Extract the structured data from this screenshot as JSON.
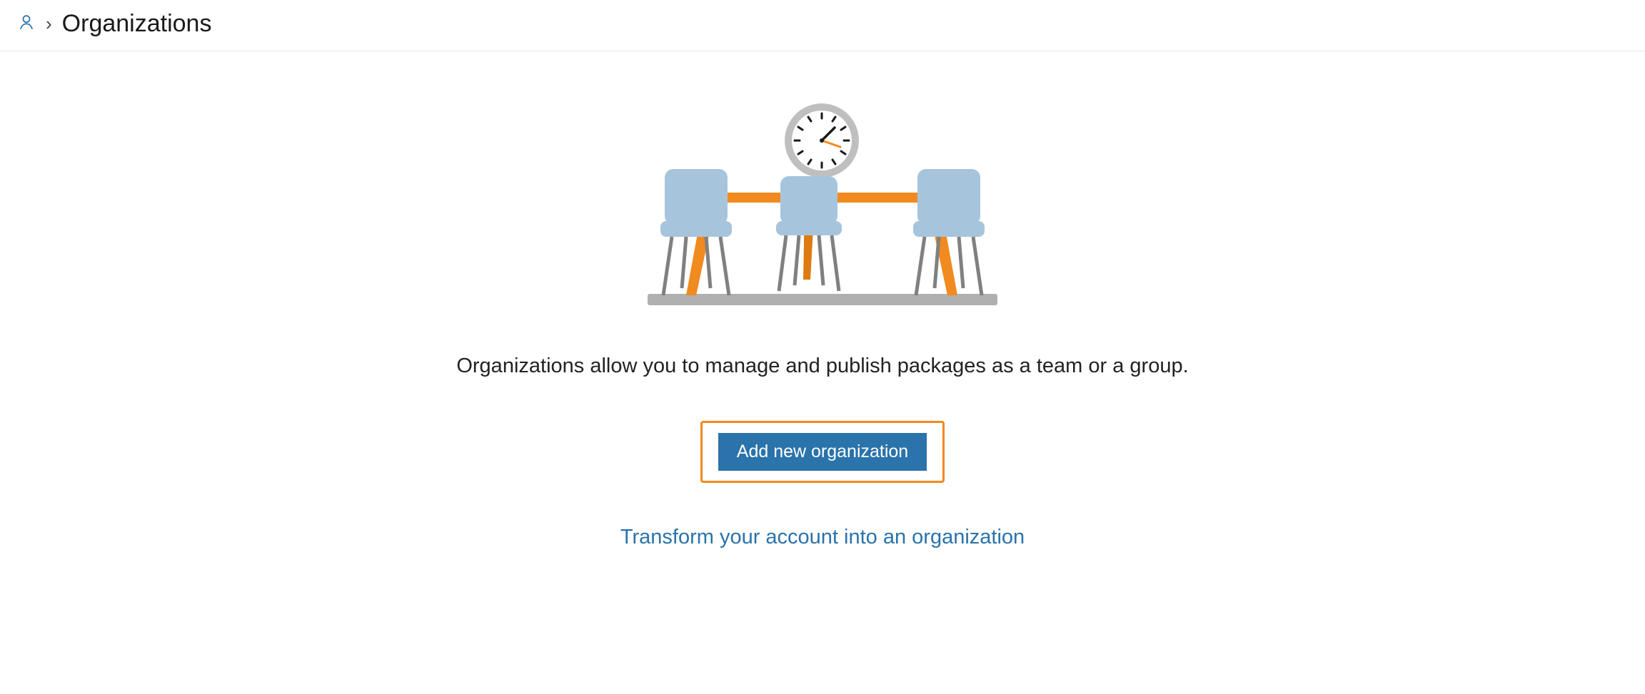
{
  "breadcrumb": {
    "title": "Organizations"
  },
  "main": {
    "description": "Organizations allow you to manage and publish packages as a team or a group.",
    "add_button_label": "Add new organization",
    "transform_link_label": "Transform your account into an organization"
  }
}
